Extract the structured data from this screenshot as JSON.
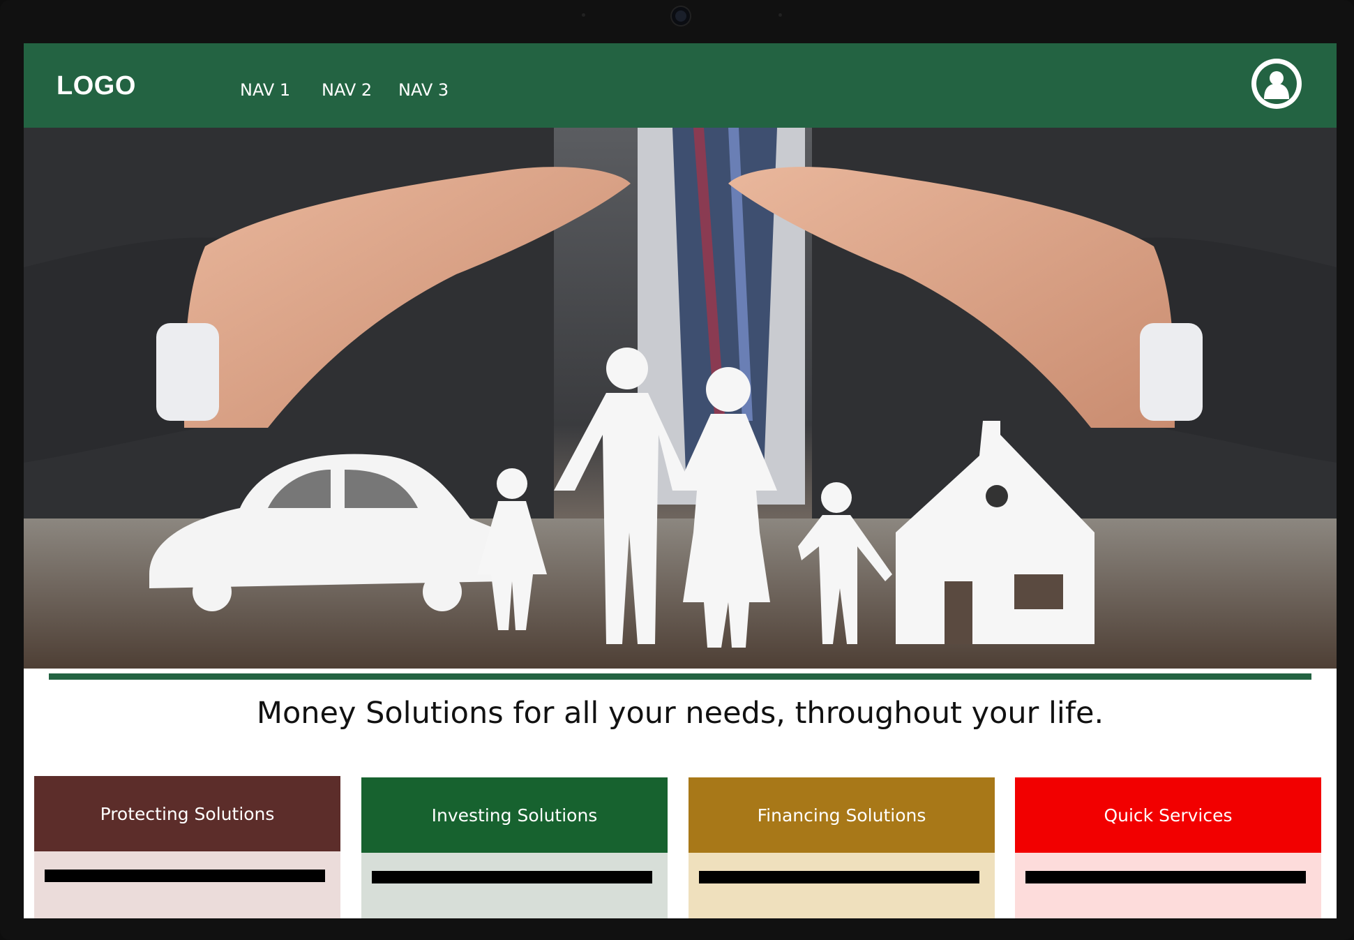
{
  "header": {
    "logo": "LOGO",
    "nav": [
      "NAV 1",
      "NAV 2",
      "NAV 3"
    ]
  },
  "hero": {
    "image_description_icon": "family-protection-photo-icon"
  },
  "tagline": "Money Solutions for all your needs, throughout your life.",
  "cards": [
    {
      "label": "Protecting Solutions",
      "head_color": "#5c2d2a",
      "body_color": "#ebdcda"
    },
    {
      "label": "Investing Solutions",
      "head_color": "#17622f",
      "body_color": "#d7ded8"
    },
    {
      "label": "Financing Solutions",
      "head_color": "#a87818",
      "body_color": "#efe0bd"
    },
    {
      "label": "Quick Services",
      "head_color": "#f20000",
      "body_color": "#fddcdb"
    }
  ],
  "colors": {
    "brand_green": "#236342",
    "background": "#ffffff"
  }
}
